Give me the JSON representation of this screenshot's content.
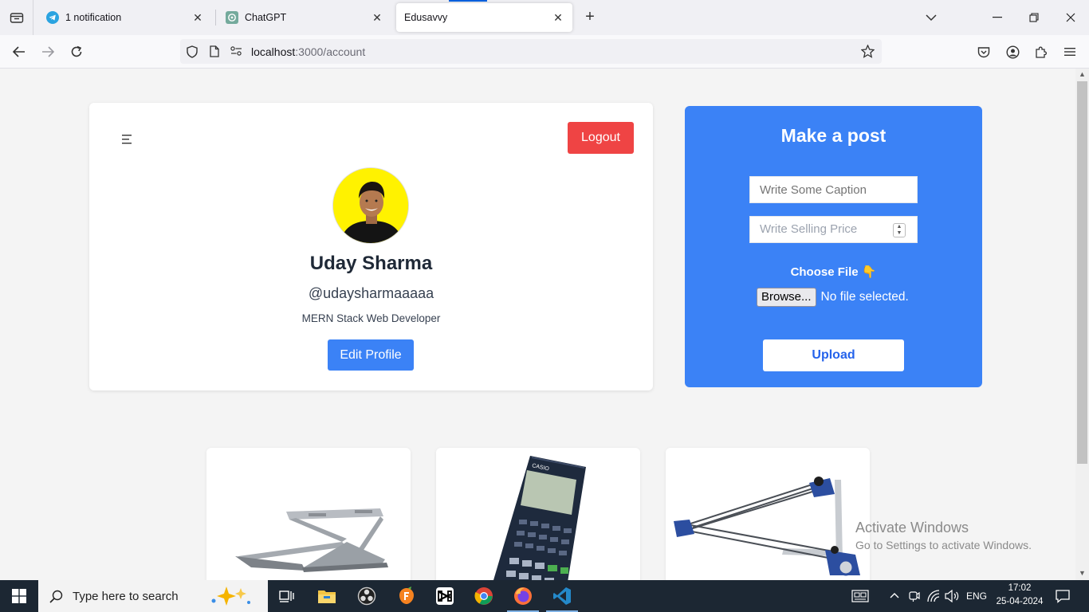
{
  "browser": {
    "tabs": [
      {
        "title": "1 notification",
        "icon": "telegram-icon"
      },
      {
        "title": "ChatGPT",
        "icon": "chatgpt-icon"
      },
      {
        "title": "Edusavvy",
        "icon": "none",
        "active": true
      }
    ],
    "url_host": "localhost",
    "url_path": ":3000/account"
  },
  "profile": {
    "logout_label": "Logout",
    "name": "Uday Sharma",
    "handle": "@udaysharmaaaaa",
    "bio": "MERN Stack Web Developer",
    "edit_label": "Edit Profile"
  },
  "post_form": {
    "title": "Make a post",
    "caption_placeholder": "Write Some Caption",
    "price_placeholder": "Write Selling Price",
    "choose_file_label": "Choose File",
    "choose_file_emoji": "👇",
    "browse_label": "Browse...",
    "no_file_text": "No file selected.",
    "upload_label": "Upload"
  },
  "products": [
    {
      "icon": "laptop-stand-icon"
    },
    {
      "icon": "calculator-icon"
    },
    {
      "icon": "drafter-icon"
    }
  ],
  "watermark": {
    "line1": "Activate Windows",
    "line2": "Go to Settings to activate Windows."
  },
  "taskbar": {
    "search_placeholder": "Type here to search",
    "language": "ENG",
    "time": "17:02",
    "date": "25-04-2024"
  },
  "colors": {
    "accent_blue": "#3b82f6",
    "logout_red": "#ef4444",
    "avatar_bg": "#fff200"
  }
}
